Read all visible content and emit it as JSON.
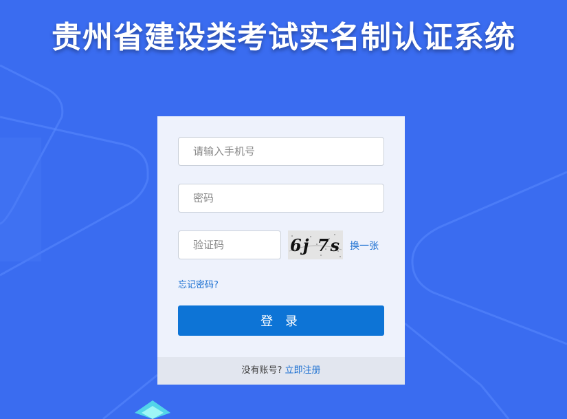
{
  "page": {
    "title": "贵州省建设类考试实名制认证系统"
  },
  "login_form": {
    "phone_placeholder": "请输入手机号",
    "password_placeholder": "密码",
    "captcha_placeholder": "验证码",
    "captcha_text": "6j 7s",
    "refresh_captcha": "换一张",
    "forgot_password": "忘记密码?",
    "login_button": "登 录"
  },
  "footer": {
    "no_account": "没有账号?",
    "register_link": "立即注册"
  },
  "colors": {
    "background": "#3a6cf0",
    "primary_button": "#0d74d6",
    "link": "#1a6fd1"
  }
}
